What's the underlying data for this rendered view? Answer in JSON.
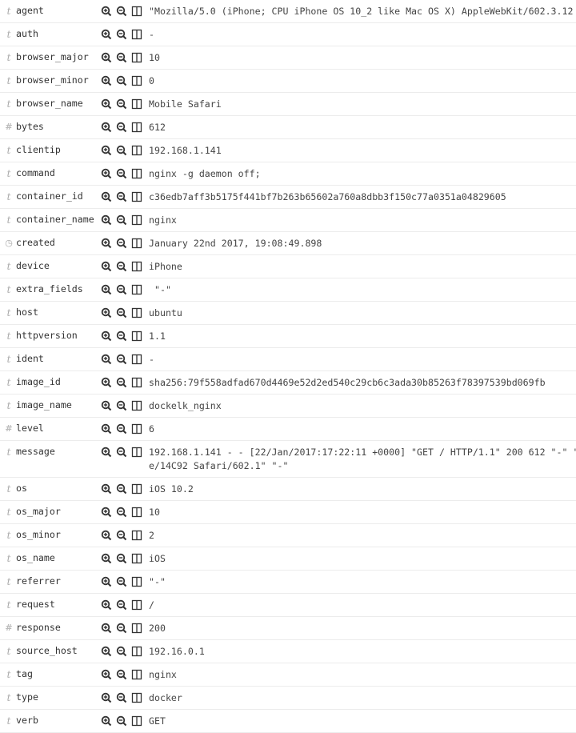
{
  "fields": [
    {
      "type": "string",
      "name": "agent",
      "value": "\"Mozilla/5.0 (iPhone; CPU iPhone OS 10_2 like Mac OS X) AppleWebKit/602.3.12"
    },
    {
      "type": "string",
      "name": "auth",
      "value": "-"
    },
    {
      "type": "string",
      "name": "browser_major",
      "value": "10"
    },
    {
      "type": "string",
      "name": "browser_minor",
      "value": "0"
    },
    {
      "type": "string",
      "name": "browser_name",
      "value": "Mobile Safari"
    },
    {
      "type": "number",
      "name": "bytes",
      "value": "612"
    },
    {
      "type": "string",
      "name": "clientip",
      "value": "192.168.1.141"
    },
    {
      "type": "string",
      "name": "command",
      "value": "nginx -g daemon off;"
    },
    {
      "type": "string",
      "name": "container_id",
      "value": "c36edb7aff3b5175f441bf7b263b65602a760a8dbb3f150c77a0351a04829605"
    },
    {
      "type": "string",
      "name": "container_name",
      "value": "nginx"
    },
    {
      "type": "date",
      "name": "created",
      "value": "January 22nd 2017, 19:08:49.898"
    },
    {
      "type": "string",
      "name": "device",
      "value": "iPhone"
    },
    {
      "type": "string",
      "name": "extra_fields",
      "value": " \"-\""
    },
    {
      "type": "string",
      "name": "host",
      "value": "ubuntu"
    },
    {
      "type": "string",
      "name": "httpversion",
      "value": "1.1"
    },
    {
      "type": "string",
      "name": "ident",
      "value": "-"
    },
    {
      "type": "string",
      "name": "image_id",
      "value": "sha256:79f558adfad670d4469e52d2ed540c29cb6c3ada30b85263f78397539bd069fb"
    },
    {
      "type": "string",
      "name": "image_name",
      "value": "dockelk_nginx"
    },
    {
      "type": "number",
      "name": "level",
      "value": "6"
    },
    {
      "type": "string",
      "name": "message",
      "value": "192.168.1.141 - - [22/Jan/2017:17:22:11 +0000] \"GET / HTTP/1.1\" 200 612 \"-\" \"\ne/14C92 Safari/602.1\" \"-\""
    },
    {
      "type": "string",
      "name": "os",
      "value": "iOS 10.2"
    },
    {
      "type": "string",
      "name": "os_major",
      "value": "10"
    },
    {
      "type": "string",
      "name": "os_minor",
      "value": "2"
    },
    {
      "type": "string",
      "name": "os_name",
      "value": "iOS"
    },
    {
      "type": "string",
      "name": "referrer",
      "value": "\"-\""
    },
    {
      "type": "string",
      "name": "request",
      "value": "/"
    },
    {
      "type": "number",
      "name": "response",
      "value": "200"
    },
    {
      "type": "string",
      "name": "source_host",
      "value": "192.16.0.1"
    },
    {
      "type": "string",
      "name": "tag",
      "value": "nginx"
    },
    {
      "type": "string",
      "name": "type",
      "value": "docker"
    },
    {
      "type": "string",
      "name": "verb",
      "value": "GET"
    }
  ],
  "type_glyphs": {
    "string": "t",
    "number": "#",
    "date": "◷"
  },
  "icons": [
    "filter-for-value-icon",
    "filter-out-value-icon",
    "toggle-column-icon"
  ]
}
